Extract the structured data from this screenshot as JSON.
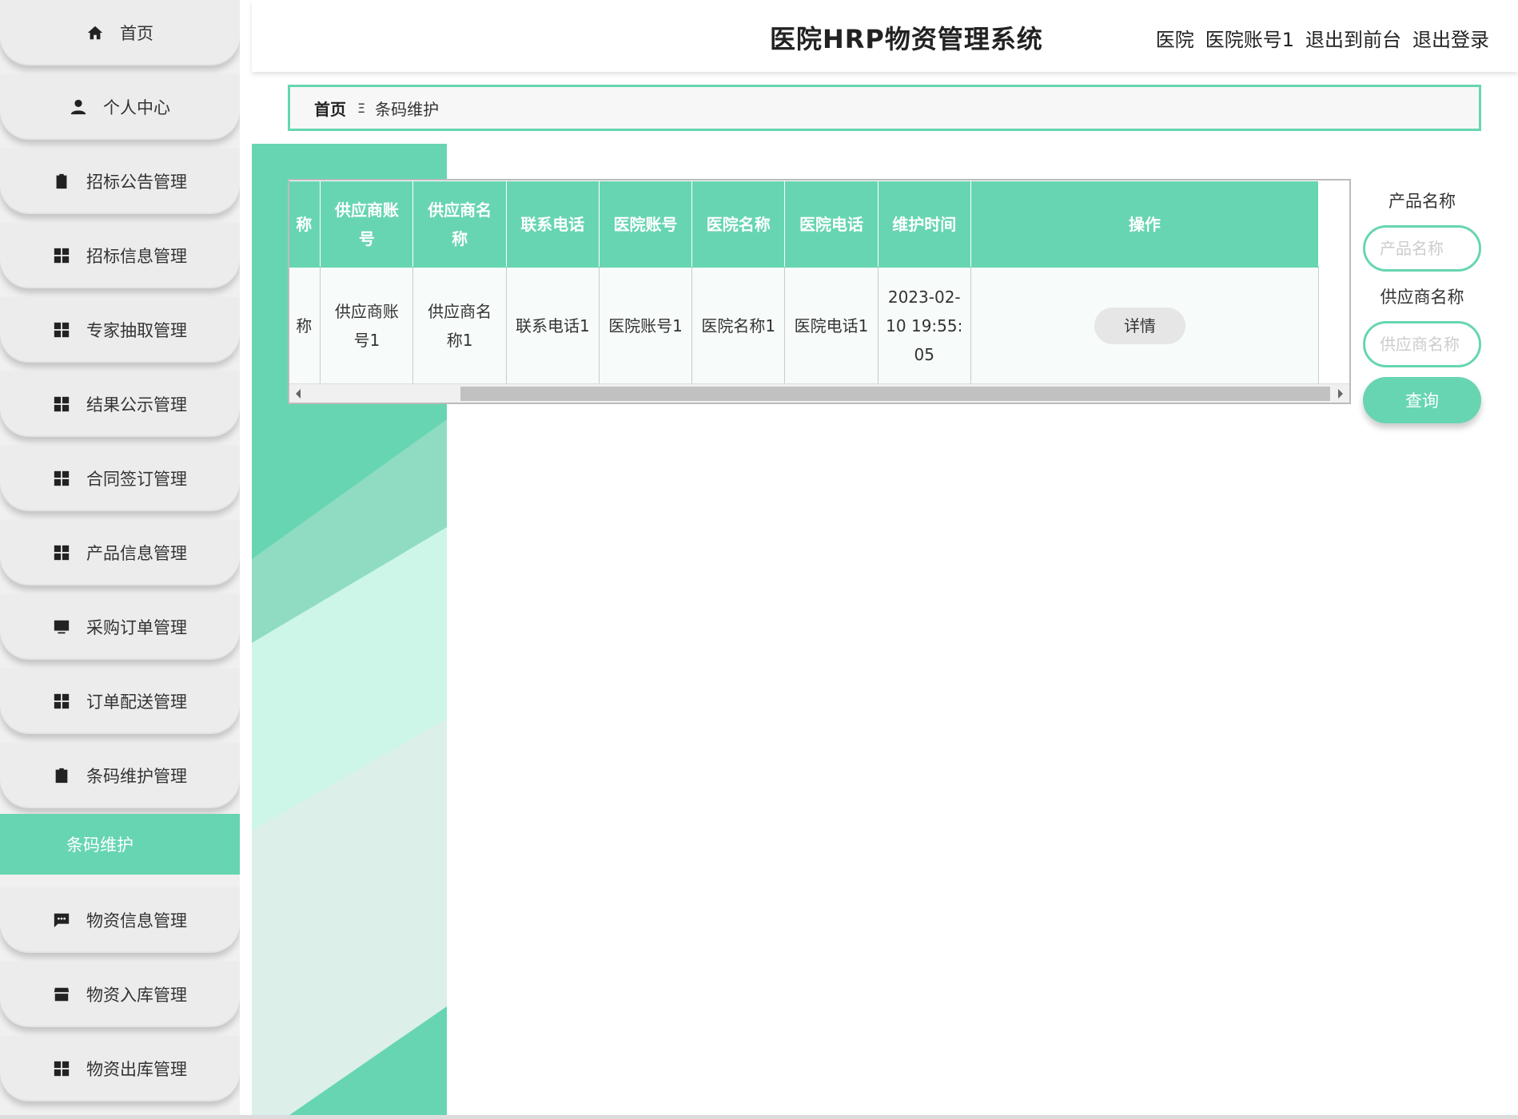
{
  "header": {
    "title": "医院HRP物资管理系统",
    "role": "医院",
    "account": "医院账号1",
    "back_to_front": "退出到前台",
    "logout": "退出登录"
  },
  "sidebar": {
    "items": [
      {
        "label": "首页",
        "icon": "home-icon"
      },
      {
        "label": "个人中心",
        "icon": "user-icon"
      },
      {
        "label": "招标公告管理",
        "icon": "clipboard-icon"
      },
      {
        "label": "招标信息管理",
        "icon": "grid-icon"
      },
      {
        "label": "专家抽取管理",
        "icon": "grid-icon"
      },
      {
        "label": "结果公示管理",
        "icon": "grid-icon"
      },
      {
        "label": "合同签订管理",
        "icon": "grid-icon"
      },
      {
        "label": "产品信息管理",
        "icon": "grid-icon"
      },
      {
        "label": "采购订单管理",
        "icon": "monitor-icon"
      },
      {
        "label": "订单配送管理",
        "icon": "grid-icon"
      },
      {
        "label": "条码维护管理",
        "icon": "clipboard-check-icon"
      },
      {
        "label": "物资信息管理",
        "icon": "chat-icon"
      },
      {
        "label": "物资入库管理",
        "icon": "store-icon"
      },
      {
        "label": "物资出库管理",
        "icon": "grid-icon"
      }
    ],
    "active_sub": "条码维护"
  },
  "breadcrumb": {
    "home": "首页",
    "separator": "Ξ",
    "current": "条码维护"
  },
  "table": {
    "columns": [
      "称",
      "供应商账号",
      "供应商名称",
      "联系电话",
      "医院账号",
      "医院名称",
      "医院电话",
      "维护时间",
      "操作"
    ],
    "rows": [
      {
        "name": "称",
        "supplier_account": "供应商账号1",
        "supplier_name": "供应商名称1",
        "phone": "联系电话1",
        "hospital_account": "医院账号1",
        "hospital_name": "医院名称1",
        "hospital_phone": "医院电话1",
        "time": "2023-02-10 19:55:05",
        "action": "详情"
      }
    ]
  },
  "search": {
    "product_label": "产品名称",
    "product_placeholder": "产品名称",
    "supplier_label": "供应商名称",
    "supplier_placeholder": "供应商名称",
    "query_label": "查询"
  },
  "colors": {
    "accent": "#67d5b2",
    "sidebar_bg": "#ececec"
  }
}
